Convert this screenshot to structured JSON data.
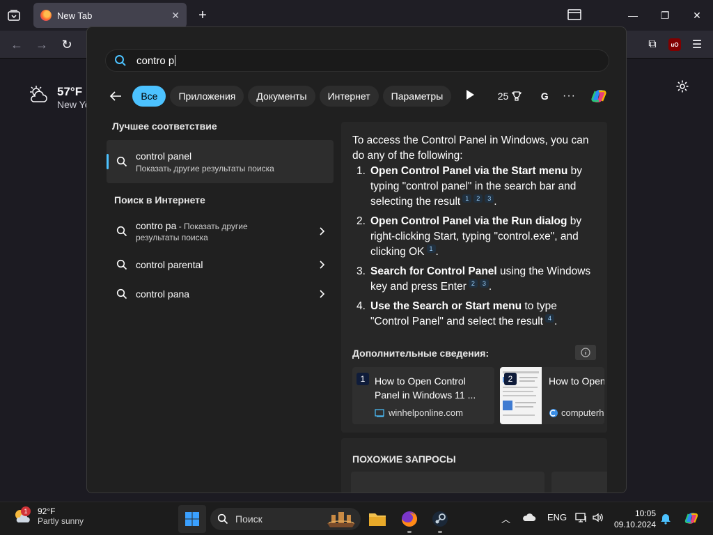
{
  "browser": {
    "tab_title": "New Tab",
    "new_tab_glyph": "+"
  },
  "newtab_page": {
    "weather_temp": "57°F",
    "weather_location": "New Yo"
  },
  "search": {
    "query": "contro p",
    "filters": [
      "Все",
      "Приложения",
      "Документы",
      "Интернет",
      "Параметры"
    ],
    "points": "25",
    "account_initial": "G",
    "more": "···"
  },
  "left": {
    "best_match_heading": "Лучшее соответствие",
    "best_match_title": "control panel",
    "best_match_sub": "Показать другие результаты поиска",
    "web_heading": "Поиск в Интернете",
    "web_items": [
      {
        "title": "contro pa",
        "suffix": " - Показать другие",
        "sub": "результаты поиска"
      },
      {
        "title": "control parental",
        "suffix": "",
        "sub": ""
      },
      {
        "title": "control pana",
        "suffix": "",
        "sub": ""
      }
    ]
  },
  "answer": {
    "intro": "To access the Control Panel in Windows, you can do any of the following:",
    "steps": [
      {
        "num": "1.",
        "bold": "Open Control Panel via the Start menu",
        "text": " by typing \"control panel\" in the search bar and selecting the result",
        "cites": [
          "1",
          "2",
          "3"
        ],
        "end": "."
      },
      {
        "num": "2.",
        "bold": "Open Control Panel via the Run dialog",
        "text": " by right-clicking Start, typing \"control.exe\", and clicking OK",
        "cites": [
          "1"
        ],
        "end": "."
      },
      {
        "num": "3.",
        "bold": "Search for Control Panel",
        "text": " using the Windows key and press Enter",
        "cites": [
          "2",
          "3"
        ],
        "end": "."
      },
      {
        "num": "4.",
        "bold": "Use the Search or Start menu",
        "text": " to type \"Control Panel\" and select the result",
        "cites": [
          "4"
        ],
        "end": "."
      }
    ],
    "more_info_heading": "Дополнительные сведения:",
    "cards": [
      {
        "n": "1",
        "title": "How to Open Control Panel in Windows 11 ...",
        "source": "winhelponline.com"
      },
      {
        "n": "2",
        "title": "How to Open Windows Co",
        "source": "computerh"
      }
    ],
    "related_heading": "ПОХОЖИЕ ЗАПРОСЫ"
  },
  "taskbar": {
    "weather_temp": "92°F",
    "weather_desc": "Partly sunny",
    "weather_badge": "1",
    "search_placeholder": "Поиск",
    "lang": "ENG",
    "time": "10:05",
    "date": "09.10.2024"
  },
  "colors": {
    "accent": "#4cc2ff",
    "panel_bg": "#202020"
  }
}
